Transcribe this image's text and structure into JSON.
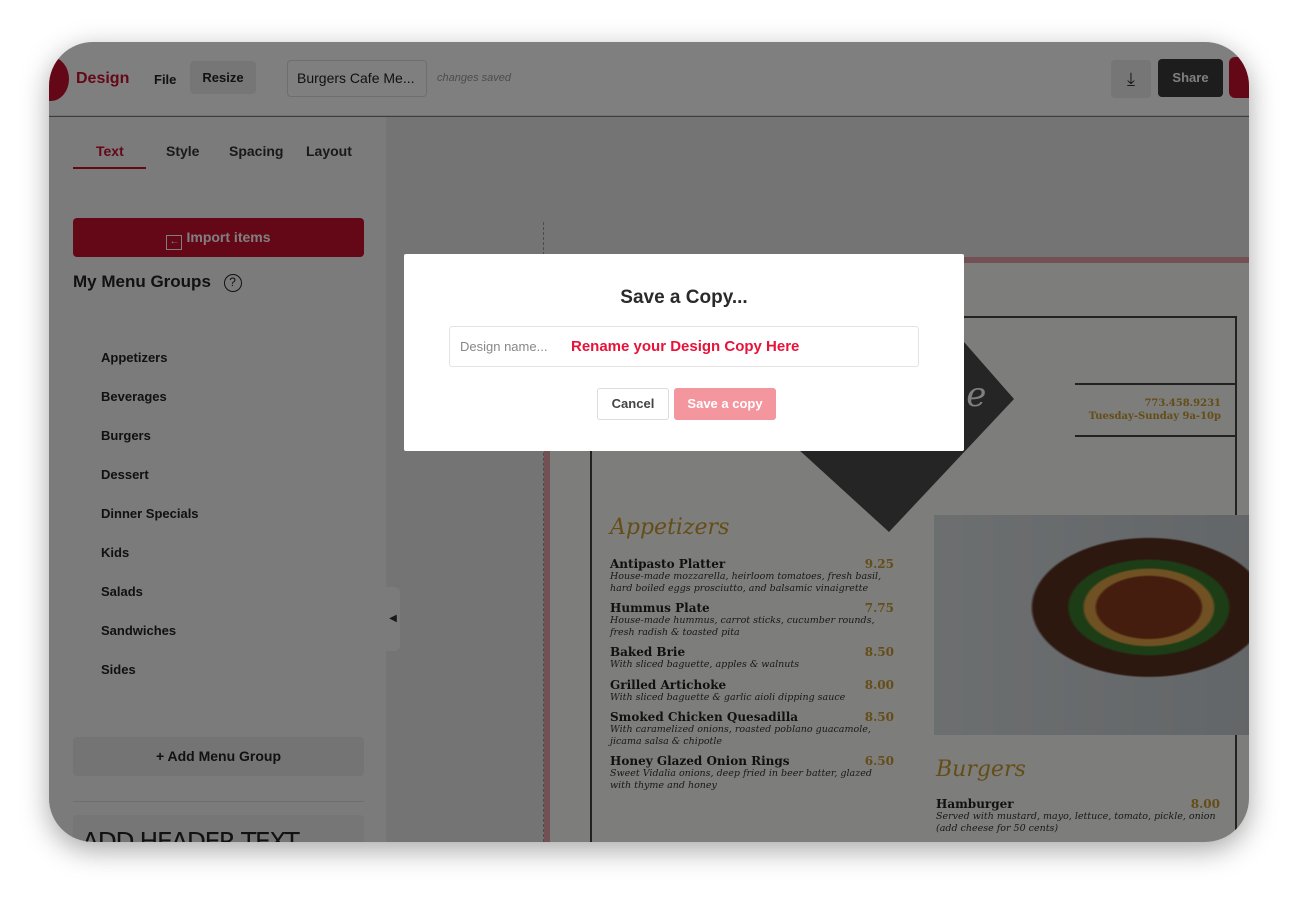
{
  "topbar": {
    "logo": "Design",
    "menu_file": "File",
    "resize": "Resize",
    "document_title": "Burgers Cafe Me...",
    "save_status": "changes saved",
    "share": "Share",
    "download_icon": "download-icon"
  },
  "sidebar": {
    "tabs": [
      "Text",
      "Style",
      "Spacing",
      "Layout"
    ],
    "active_tab": "Text",
    "import_button": "Import items",
    "groups_title": "My Menu Groups",
    "help_glyph": "?",
    "groups": [
      "Appetizers",
      "Beverages",
      "Burgers",
      "Dessert",
      "Dinner Specials",
      "Kids",
      "Salads",
      "Sandwiches",
      "Sides"
    ],
    "add_group": "+ Add Menu Group",
    "header_text": "ADD HEADER TEXT"
  },
  "canvas": {
    "banner_text": "me",
    "phone": "773.458.9231",
    "hours": "Tuesday-Sunday 9a-10p",
    "appetizers_heading": "Appetizers",
    "appetizers": [
      {
        "name": "Antipasto Platter",
        "price": "9.25",
        "desc": "House-made mozzarella, heirloom tomatoes, fresh basil, hard boiled eggs prosciutto, and balsamic vinaigrette"
      },
      {
        "name": "Hummus Plate",
        "price": "7.75",
        "desc": "House-made hummus, carrot sticks, cucumber rounds, fresh radish & toasted pita"
      },
      {
        "name": "Baked Brie",
        "price": "8.50",
        "desc": "With sliced baguette, apples & walnuts"
      },
      {
        "name": "Grilled Artichoke",
        "price": "8.00",
        "desc": "With sliced baguette & garlic aioli dipping sauce"
      },
      {
        "name": "Smoked Chicken Quesadilla",
        "price": "8.50",
        "desc": "With caramelized onions, roasted poblano guacamole, jicama salsa & chipotle"
      },
      {
        "name": "Honey Glazed Onion Rings",
        "price": "6.50",
        "desc": "Sweet Vidalia onions, deep fried in beer batter, glazed with thyme and honey"
      }
    ],
    "burgers_heading": "Burgers",
    "burgers": [
      {
        "name": "Hamburger",
        "price": "8.00",
        "desc": "Served with mustard, mayo, lettuce, tomato, pickle, onion (add cheese for 50 cents)"
      }
    ]
  },
  "modal": {
    "title": "Save a Copy...",
    "name_placeholder": "Design name...",
    "name_hint": "Rename your Design Copy Here",
    "cancel": "Cancel",
    "save": "Save a copy"
  },
  "colors": {
    "brand_red": "#c8102e",
    "save_button_disabled": "#f4969e",
    "hint_red": "#e8123a",
    "menu_gold": "#c99a2e"
  }
}
